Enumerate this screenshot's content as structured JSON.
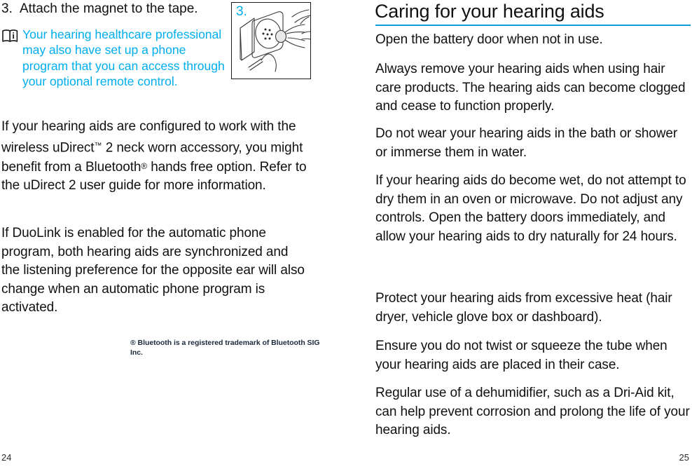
{
  "left_page": {
    "page_number": "24",
    "step": {
      "number": "3.",
      "text": "Attach the magnet to the tape."
    },
    "note": {
      "icon": "instructions-manual-icon",
      "text": "Your hearing healthcare professional may also have set up a phone program that you can access through your optional remote control.",
      "color": "#00aeef"
    },
    "illustration": {
      "name": "magnet-attach-to-phone-illustration",
      "label": "3.",
      "label_color": "#00aeef"
    },
    "paragraphs": [
      {
        "id": "udirect-paragraph",
        "parts": [
          {
            "text": "If your hearing aids are configured to work with the wireless uDirect"
          },
          {
            "text": "™",
            "style": "superscript-tm"
          },
          {
            "text": " 2 neck worn accessory, you might benefit from a Bluetooth"
          },
          {
            "text": "®",
            "style": "superscript-reg"
          },
          {
            "text": " hands free option. Refer to the uDirect 2 user guide for more information."
          }
        ]
      },
      {
        "id": "duolink-paragraph",
        "parts": [
          {
            "text": "If DuoLink is enabled for the automatic phone program, both hearing aids are synchronized and the listening preference for the opposite ear will also change when an automatic phone program is activated."
          }
        ]
      }
    ],
    "footnote": "® Bluetooth is a registered trademark of Bluetooth SIG Inc."
  },
  "right_page": {
    "page_number": "25",
    "title": "Caring for your hearing aids",
    "rule_color": "#0d9ddb",
    "paragraphs": [
      "Open the battery door when not in use.",
      "Always remove your hearing aids when using hair care products. The hearing aids can become clogged and cease to function properly.",
      "Do not wear your hearing aids in the bath or shower or immerse them in water.",
      "If your hearing aids do become wet, do not attempt to dry them in an oven or microwave. Do not adjust any controls. Open the battery doors immediately, and allow your hearing aids to dry naturally for 24 hours.",
      "Protect your hearing aids from excessive heat (hair dryer, vehicle glove box or dashboard).",
      "Ensure you do not twist or squeeze the tube when your hearing aids are placed in their case.",
      "Regular use of a dehumidifier, such as a Dri-Aid kit, can help prevent corrosion and prolong the life of your hearing aids."
    ]
  }
}
